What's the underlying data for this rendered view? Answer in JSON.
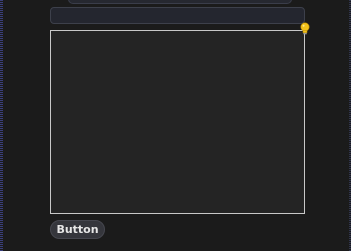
{
  "form": {
    "text_input": {
      "value": "",
      "placeholder": ""
    },
    "text_area": {
      "value": "",
      "placeholder": ""
    },
    "button_label": "Button"
  },
  "icons": {
    "indicator": "lightbulb-icon"
  },
  "colors": {
    "background": "#1b1b1b",
    "input_background": "#24262f",
    "textarea_border": "#c8c8c8",
    "bulb_yellow": "#f2c21b",
    "button_background": "#35363c"
  }
}
